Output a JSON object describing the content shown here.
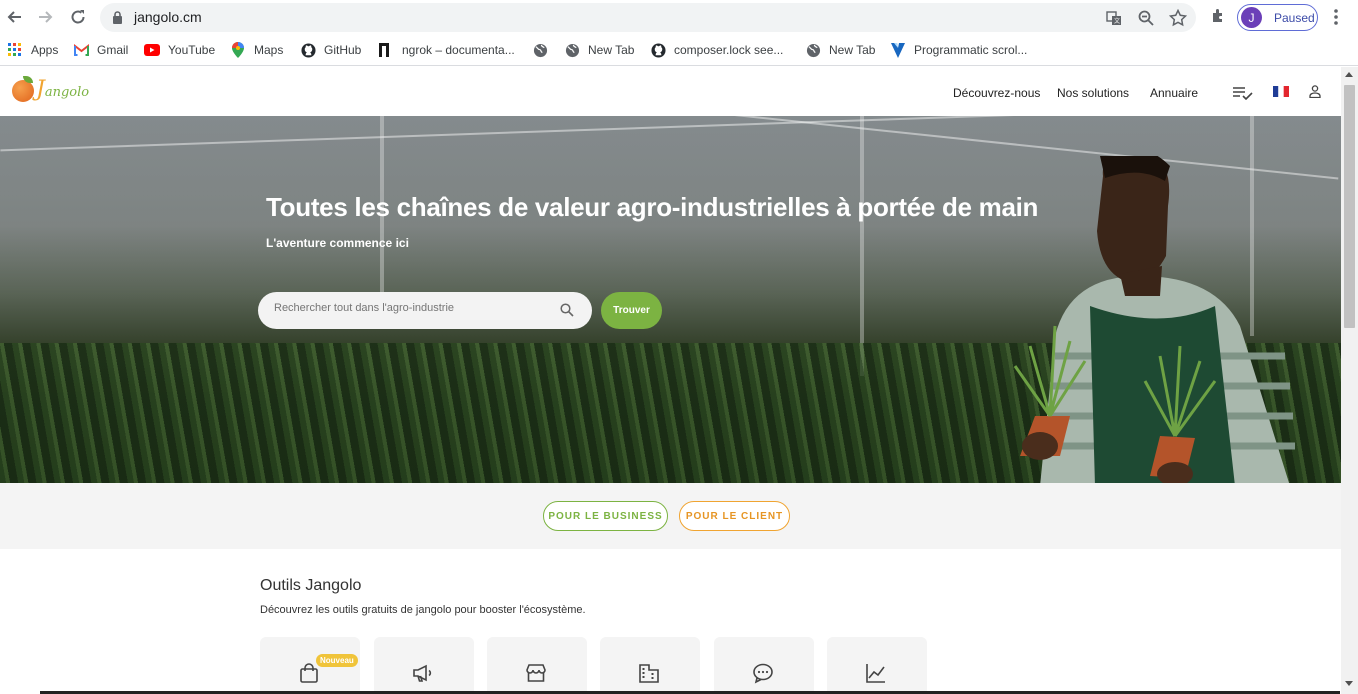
{
  "browser": {
    "url": "jangolo.cm",
    "profile_initial": "J",
    "profile_status": "Paused"
  },
  "bookmarks": [
    {
      "label": "Apps",
      "icon": "apps-grid-icon"
    },
    {
      "label": "Gmail",
      "icon": "gmail-icon"
    },
    {
      "label": "YouTube",
      "icon": "youtube-icon"
    },
    {
      "label": "Maps",
      "icon": "maps-pin-icon"
    },
    {
      "label": "GitHub",
      "icon": "github-icon"
    },
    {
      "label": "ngrok – documenta...",
      "icon": "ngrok-icon"
    },
    {
      "label": "",
      "icon": "globe-icon"
    },
    {
      "label": "New Tab",
      "icon": "globe-icon"
    },
    {
      "label": "composer.lock see...",
      "icon": "github-icon"
    },
    {
      "label": "New Tab",
      "icon": "globe-icon"
    },
    {
      "label": "Programmatic scrol...",
      "icon": "vuetify-icon"
    }
  ],
  "header": {
    "nav": [
      "Découvrez-nous",
      "Nos solutions",
      "Annuaire"
    ]
  },
  "hero": {
    "title": "Toutes les chaînes de valeur agro-industrielles à portée de main",
    "subtitle": "L'aventure commence ici",
    "search_placeholder": "Rechercher tout dans l'agro-industrie",
    "search_button": "Trouver"
  },
  "audience": {
    "business": "POUR LE BUSINESS",
    "client": "POUR LE CLIENT"
  },
  "tools": {
    "title": "Outils Jangolo",
    "description": "Découvrez les outils gratuits de jangolo pour booster l'écosystème.",
    "badge": "Nouveau",
    "cards": [
      "shopping-bag-icon",
      "megaphone-icon",
      "storefront-icon",
      "building-icon",
      "chat-bubble-icon",
      "line-chart-icon"
    ]
  },
  "colors": {
    "brand_green": "#7cb342",
    "brand_orange": "#f0a431"
  }
}
